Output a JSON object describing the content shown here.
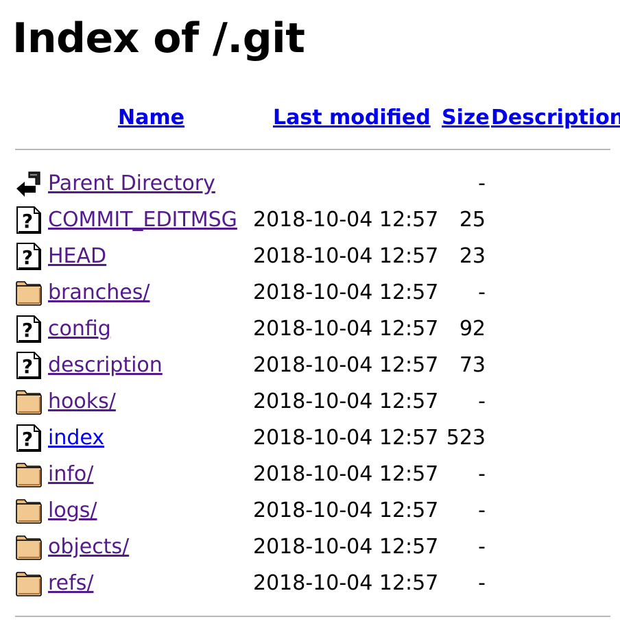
{
  "title": "Index of /.git",
  "columns": {
    "name": "Name",
    "last_modified": "Last modified",
    "size": "Size",
    "description": "Description"
  },
  "rows": [
    {
      "name": "Parent Directory",
      "date": "",
      "size": "-",
      "icon": "back-arrow-icon",
      "link": "visited"
    },
    {
      "name": "COMMIT_EDITMSG",
      "date": "2018-10-04 12:57",
      "size": "25",
      "icon": "unknown-file-icon",
      "link": "visited"
    },
    {
      "name": "HEAD",
      "date": "2018-10-04 12:57",
      "size": "23",
      "icon": "unknown-file-icon",
      "link": "visited"
    },
    {
      "name": "branches/",
      "date": "2018-10-04 12:57",
      "size": "-",
      "icon": "folder-icon",
      "link": "visited"
    },
    {
      "name": "config",
      "date": "2018-10-04 12:57",
      "size": "92",
      "icon": "unknown-file-icon",
      "link": "visited"
    },
    {
      "name": "description",
      "date": "2018-10-04 12:57",
      "size": "73",
      "icon": "unknown-file-icon",
      "link": "visited"
    },
    {
      "name": "hooks/",
      "date": "2018-10-04 12:57",
      "size": "-",
      "icon": "folder-icon",
      "link": "visited"
    },
    {
      "name": "index",
      "date": "2018-10-04 12:57",
      "size": "523",
      "icon": "unknown-file-icon",
      "link": "unvisited"
    },
    {
      "name": "info/",
      "date": "2018-10-04 12:57",
      "size": "-",
      "icon": "folder-icon",
      "link": "visited"
    },
    {
      "name": "logs/",
      "date": "2018-10-04 12:57",
      "size": "-",
      "icon": "folder-icon",
      "link": "visited"
    },
    {
      "name": "objects/",
      "date": "2018-10-04 12:57",
      "size": "-",
      "icon": "folder-icon",
      "link": "visited"
    },
    {
      "name": "refs/",
      "date": "2018-10-04 12:57",
      "size": "-",
      "icon": "folder-icon",
      "link": "visited"
    }
  ],
  "colors": {
    "link_unvisited": "#0000ee",
    "link_visited": "#551a8b",
    "folder_fill": "#f0c890",
    "rule": "#b8b8b8"
  }
}
